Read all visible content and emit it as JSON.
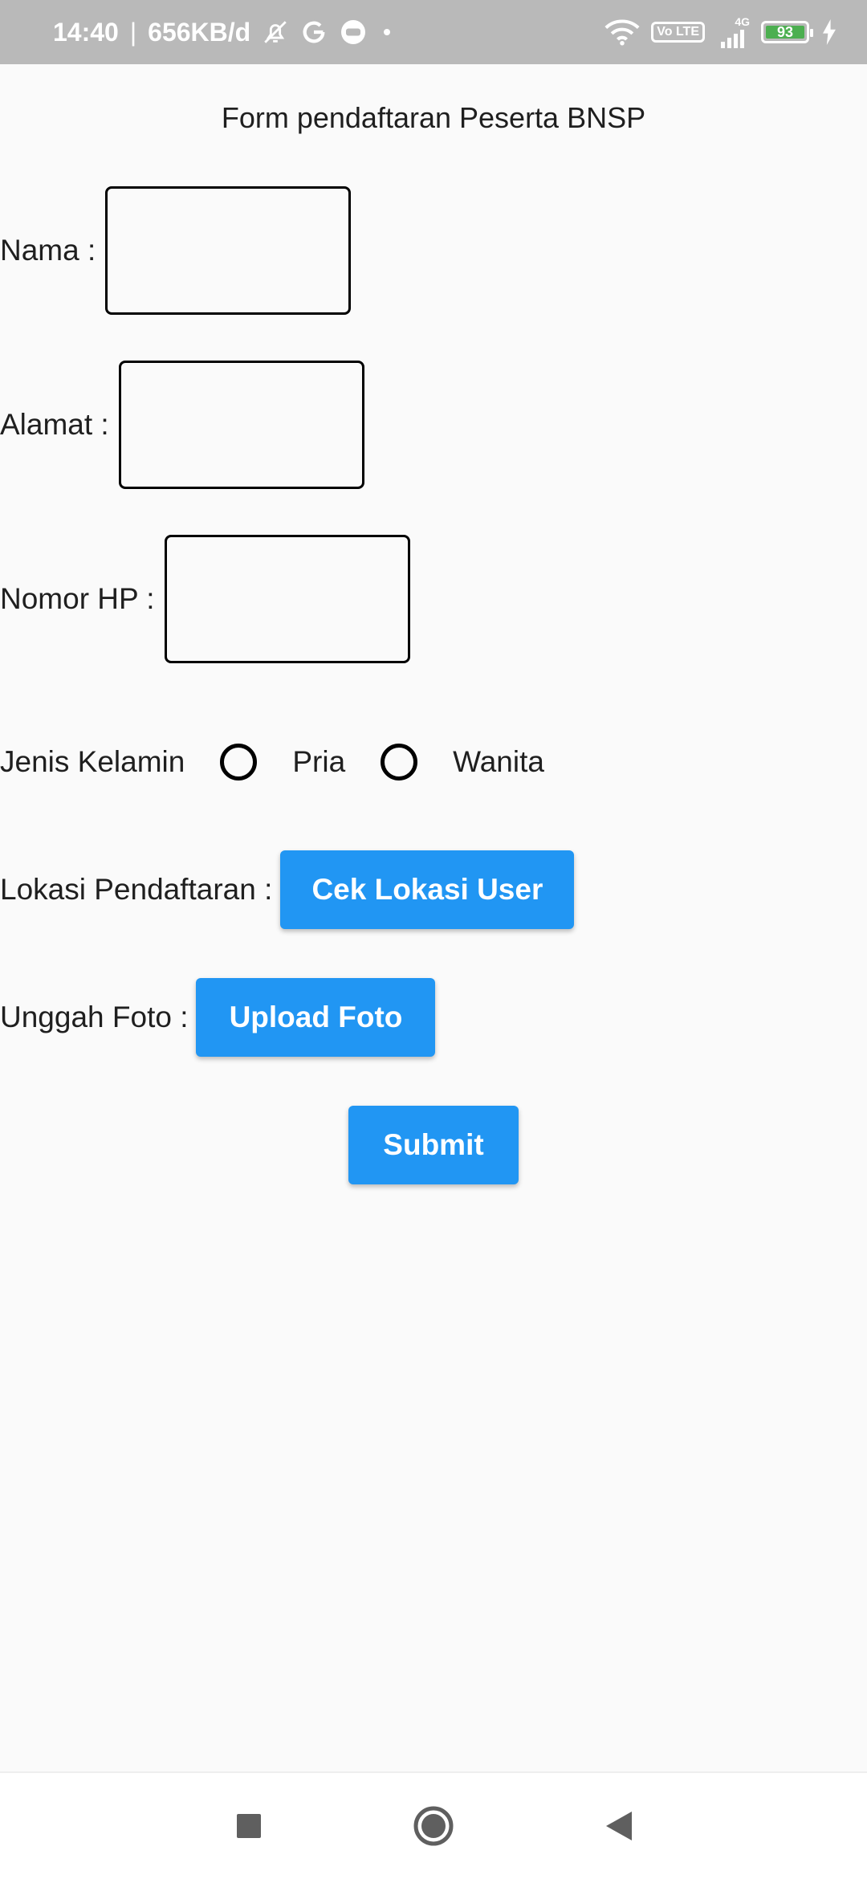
{
  "status_bar": {
    "time": "14:40",
    "separator": "|",
    "data_rate": "656KB/d",
    "lte_label": "Vo LTE",
    "network": "4G",
    "battery_level": "93",
    "colors": {
      "background": "#b9b9b9",
      "battery_fill": "#4caf50"
    },
    "icons": [
      "mute-bell-icon",
      "google-icon",
      "chat-bubble-icon",
      "dot-icon",
      "wifi-icon",
      "volte-icon",
      "signal-icon",
      "battery-icon",
      "charging-bolt-icon"
    ]
  },
  "form": {
    "title": "Form pendaftaran Peserta BNSP",
    "fields": {
      "nama_label": "Nama :",
      "nama_value": "",
      "alamat_label": "Alamat :",
      "alamat_value": "",
      "nomor_hp_label": "Nomor HP :",
      "nomor_hp_value": ""
    },
    "gender": {
      "label": "Jenis Kelamin",
      "options": [
        "Pria",
        "Wanita"
      ],
      "selected": null
    },
    "location": {
      "label": "Lokasi Pendaftaran :",
      "button_label": "Cek Lokasi User"
    },
    "photo": {
      "label": "Unggah Foto :",
      "button_label": "Upload Foto"
    },
    "submit_label": "Submit",
    "colors": {
      "button": "#2196f3",
      "background": "#fafafa"
    }
  },
  "nav_bar": {
    "icons": [
      "recents-square-icon",
      "home-circle-icon",
      "back-triangle-icon"
    ]
  }
}
